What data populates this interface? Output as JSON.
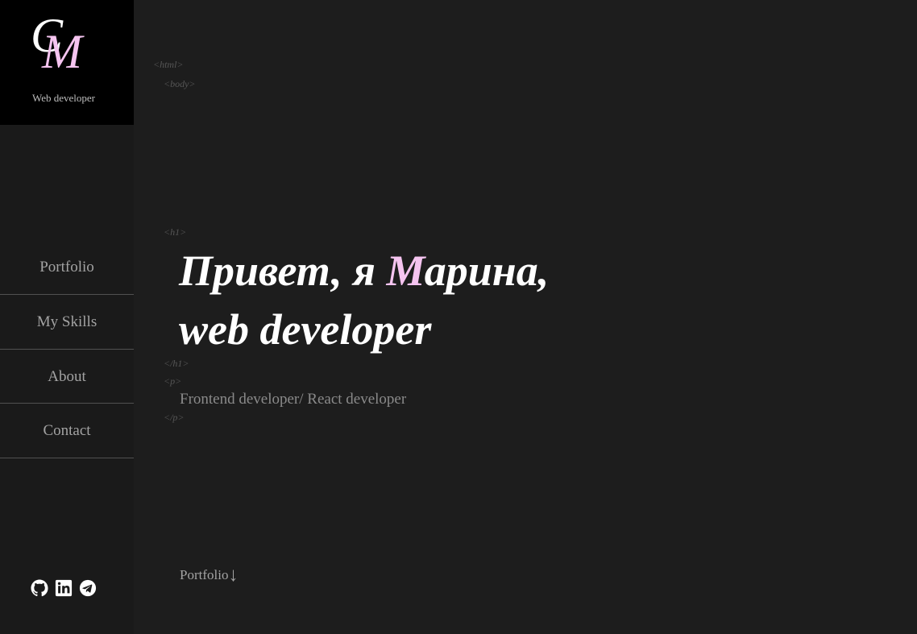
{
  "logo": {
    "letter_c": "C",
    "letter_m": "M",
    "subtitle": "Web developer"
  },
  "nav": {
    "items": [
      {
        "label": "Portfolio"
      },
      {
        "label": "My Skills"
      },
      {
        "label": "About"
      },
      {
        "label": "Contact"
      }
    ]
  },
  "social": {
    "icons": [
      "github-icon",
      "linkedin-icon",
      "telegram-icon"
    ]
  },
  "code_tags": {
    "html": "<html>",
    "body": "<body>",
    "h1_open": "<h1>",
    "h1_close": "</h1>",
    "p_open": "<p>",
    "p_close": "</p>"
  },
  "hero": {
    "line1_before": "Привет, я ",
    "line1_accent": "М",
    "line1_after": "арина,",
    "line2": "web developer",
    "subtitle": "Frontend developer/ React developer"
  },
  "scroll_link": {
    "label": "Portfolio",
    "arrow": "↓"
  },
  "colors": {
    "accent": "#f5c4f0",
    "background": "#1d1d1d",
    "sidebar": "#1a1a1a",
    "logo_bg": "#000000",
    "tag_text": "#565656",
    "nav_text": "#a3a3a3"
  }
}
